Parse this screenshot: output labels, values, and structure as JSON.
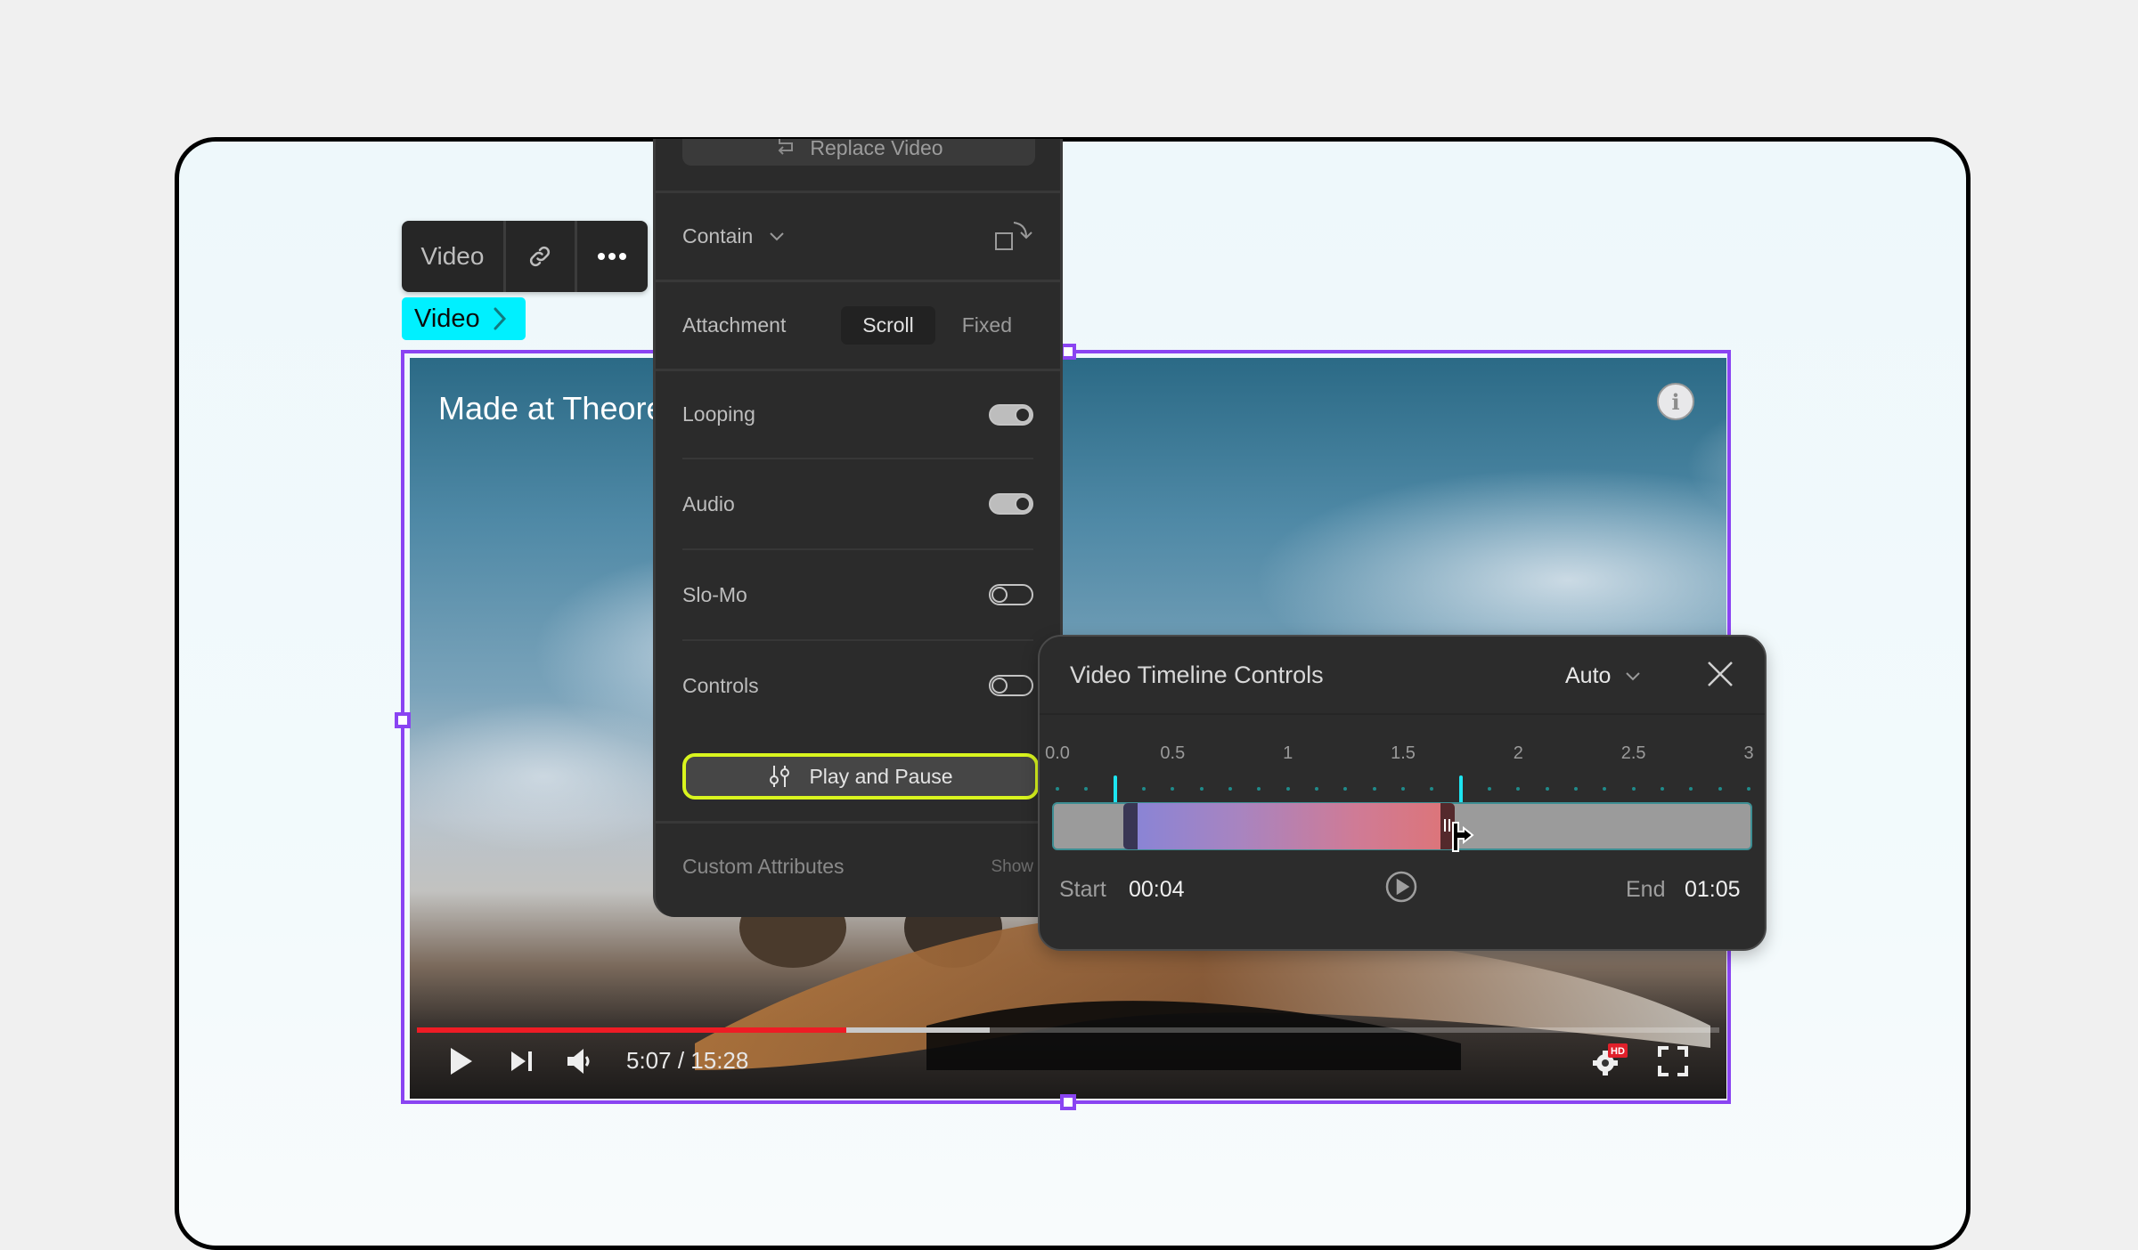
{
  "toolbar": {
    "element_label": "Video",
    "link_icon": "link-icon",
    "more_icon": "more-horizontal-icon"
  },
  "element_tag": {
    "label": "Video",
    "icon": "chevron-right-icon",
    "color": "#00f0ff"
  },
  "selection": {
    "color": "#8a44f2"
  },
  "video": {
    "title": "Made at Theore",
    "info_icon": "info-icon",
    "time_display": "5:07 / 15:28",
    "progress_played_fraction": 0.33,
    "progress_buffered_fraction": 0.44,
    "progress_color": "#ee1c25",
    "controls": {
      "play_icon": "play-icon",
      "next_icon": "skip-next-icon",
      "volume_icon": "volume-icon",
      "settings_icon": "settings-gear-icon",
      "hd_badge": "HD",
      "fullscreen_icon": "fullscreen-icon"
    }
  },
  "settings_panel": {
    "replace_button": "Replace Video",
    "fit": {
      "value": "Contain",
      "rotate_icon": "rotate-icon"
    },
    "attachment": {
      "label": "Attachment",
      "options": [
        "Scroll",
        "Fixed"
      ],
      "selected": "Scroll"
    },
    "toggles": [
      {
        "label": "Looping",
        "on": true
      },
      {
        "label": "Audio",
        "on": true
      },
      {
        "label": "Slo-Mo",
        "on": false
      },
      {
        "label": "Controls",
        "on": false
      }
    ],
    "play_pause_button": {
      "label": "Play and Pause",
      "icon": "sliders-icon",
      "highlight_color": "#d9f51e"
    },
    "custom_attributes": {
      "label": "Custom Attributes",
      "action": "Show"
    }
  },
  "timeline_panel": {
    "title": "Video Timeline Controls",
    "mode": "Auto",
    "close_icon": "close-icon",
    "ruler": {
      "labels": [
        "0.0",
        "0.5",
        "1",
        "1.5",
        "2",
        "2.5",
        "3"
      ],
      "min": 0,
      "max": 3,
      "markers": [
        0.25,
        1.75
      ],
      "marker_color": "#1de4f0"
    },
    "range": {
      "start_fraction": 0.1,
      "end_fraction": 0.575
    },
    "start_label": "Start",
    "start_value": "00:04",
    "end_label": "End",
    "end_value": "01:05",
    "play_icon": "play-circle-icon"
  }
}
